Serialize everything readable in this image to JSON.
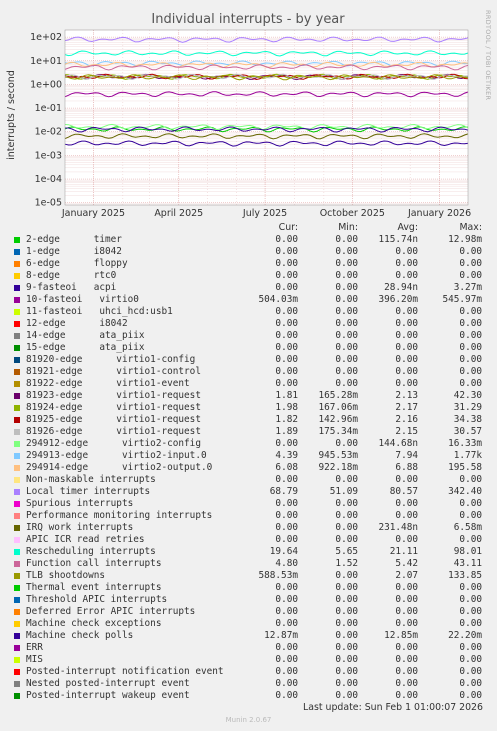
{
  "chart_data": {
    "type": "line",
    "title": "Individual interrupts - by year",
    "ylabel": "interrupts / second",
    "yscale": "log",
    "ylim": [
      8e-06,
      200
    ],
    "yticks": [
      {
        "value": 100,
        "label": "1e+02"
      },
      {
        "value": 10,
        "label": "1e+01"
      },
      {
        "value": 1,
        "label": "1e+00"
      },
      {
        "value": 0.1,
        "label": "1e-01"
      },
      {
        "value": 0.01,
        "label": "1e-02"
      },
      {
        "value": 0.001,
        "label": "1e-03"
      },
      {
        "value": 0.0001,
        "label": "1e-04"
      },
      {
        "value": 1e-05,
        "label": "1e-05"
      }
    ],
    "xlim": [
      "2024-12-02",
      "2026-01-31"
    ],
    "xticks": [
      {
        "date": "2025-01-01",
        "label": "January 2025"
      },
      {
        "date": "2025-04-01",
        "label": "April 2025"
      },
      {
        "date": "2025-07-01",
        "label": "July 2025"
      },
      {
        "date": "2025-10-01",
        "label": "October 2025"
      },
      {
        "date": "2026-01-01",
        "label": "January 2026"
      }
    ],
    "side_text": "RRDTOOL / TOBI OETIKER",
    "columns": [
      "Cur:",
      "Min:",
      "Avg:",
      "Max:"
    ],
    "series": [
      {
        "name": "2-edge      timer",
        "color": "#00cc00",
        "cur": "0.00",
        "min": "0.00",
        "avg": "115.74n",
        "max": "12.98m"
      },
      {
        "name": "1-edge      i8042",
        "color": "#0066b3",
        "cur": "0.00",
        "min": "0.00",
        "avg": "0.00",
        "max": "0.00"
      },
      {
        "name": "6-edge      floppy",
        "color": "#ff8000",
        "cur": "0.00",
        "min": "0.00",
        "avg": "0.00",
        "max": "0.00"
      },
      {
        "name": "8-edge      rtc0",
        "color": "#ffcc00",
        "cur": "0.00",
        "min": "0.00",
        "avg": "0.00",
        "max": "0.00"
      },
      {
        "name": "9-fasteoi   acpi",
        "color": "#330099",
        "cur": "0.00",
        "min": "0.00",
        "avg": "28.94n",
        "max": "3.27m"
      },
      {
        "name": "10-fasteoi   virtio0",
        "color": "#990099",
        "cur": "504.03m",
        "min": "0.00",
        "avg": "396.20m",
        "max": "545.97m"
      },
      {
        "name": "11-fasteoi   uhci_hcd:usb1",
        "color": "#ccff00",
        "cur": "0.00",
        "min": "0.00",
        "avg": "0.00",
        "max": "0.00"
      },
      {
        "name": "12-edge      i8042",
        "color": "#ff0000",
        "cur": "0.00",
        "min": "0.00",
        "avg": "0.00",
        "max": "0.00"
      },
      {
        "name": "14-edge      ata_piix",
        "color": "#808080",
        "cur": "0.00",
        "min": "0.00",
        "avg": "0.00",
        "max": "0.00"
      },
      {
        "name": "15-edge      ata_piix",
        "color": "#008f00",
        "cur": "0.00",
        "min": "0.00",
        "avg": "0.00",
        "max": "0.00"
      },
      {
        "name": "81920-edge      virtio1-config",
        "color": "#00487d",
        "cur": "0.00",
        "min": "0.00",
        "avg": "0.00",
        "max": "0.00"
      },
      {
        "name": "81921-edge      virtio1-control",
        "color": "#b35a00",
        "cur": "0.00",
        "min": "0.00",
        "avg": "0.00",
        "max": "0.00"
      },
      {
        "name": "81922-edge      virtio1-event",
        "color": "#b38f00",
        "cur": "0.00",
        "min": "0.00",
        "avg": "0.00",
        "max": "0.00"
      },
      {
        "name": "81923-edge      virtio1-request",
        "color": "#6b006b",
        "cur": "1.81",
        "min": "165.28m",
        "avg": "2.13",
        "max": "42.30"
      },
      {
        "name": "81924-edge      virtio1-request",
        "color": "#8fb300",
        "cur": "1.98",
        "min": "167.06m",
        "avg": "2.17",
        "max": "31.29"
      },
      {
        "name": "81925-edge      virtio1-request",
        "color": "#b30000",
        "cur": "1.82",
        "min": "142.96m",
        "avg": "2.16",
        "max": "34.38"
      },
      {
        "name": "81926-edge      virtio1-request",
        "color": "#bebebe",
        "cur": "1.89",
        "min": "175.34m",
        "avg": "2.15",
        "max": "30.57"
      },
      {
        "name": "294912-edge      virtio2-config",
        "color": "#80ff80",
        "cur": "0.00",
        "min": "0.00",
        "avg": "144.68n",
        "max": "16.33m"
      },
      {
        "name": "294913-edge      virtio2-input.0",
        "color": "#80c9ff",
        "cur": "4.39",
        "min": "945.53m",
        "avg": "7.94",
        "max": "1.77k"
      },
      {
        "name": "294914-edge      virtio2-output.0",
        "color": "#ffc080",
        "cur": "6.08",
        "min": "922.18m",
        "avg": "6.88",
        "max": "195.58"
      },
      {
        "name": "Non-maskable interrupts",
        "color": "#ffe680",
        "cur": "0.00",
        "min": "0.00",
        "avg": "0.00",
        "max": "0.00"
      },
      {
        "name": "Local timer interrupts",
        "color": "#aa80ff",
        "cur": "68.79",
        "min": "51.09",
        "avg": "80.57",
        "max": "342.40"
      },
      {
        "name": "Spurious interrupts",
        "color": "#ee00cc",
        "cur": "0.00",
        "min": "0.00",
        "avg": "0.00",
        "max": "0.00"
      },
      {
        "name": "Performance monitoring interrupts",
        "color": "#ff8080",
        "cur": "0.00",
        "min": "0.00",
        "avg": "0.00",
        "max": "0.00"
      },
      {
        "name": "IRQ work interrupts",
        "color": "#666600",
        "cur": "0.00",
        "min": "0.00",
        "avg": "231.48n",
        "max": "6.58m"
      },
      {
        "name": "APIC ICR read retries",
        "color": "#ffbfff",
        "cur": "0.00",
        "min": "0.00",
        "avg": "0.00",
        "max": "0.00"
      },
      {
        "name": "Rescheduling interrupts",
        "color": "#00ffcc",
        "cur": "19.64",
        "min": "5.65",
        "avg": "21.11",
        "max": "98.01"
      },
      {
        "name": "Function call interrupts",
        "color": "#cc6699",
        "cur": "4.80",
        "min": "1.52",
        "avg": "5.42",
        "max": "43.11"
      },
      {
        "name": "TLB shootdowns",
        "color": "#999900",
        "cur": "588.53m",
        "min": "0.00",
        "avg": "2.07",
        "max": "133.85"
      },
      {
        "name": "Thermal event interrupts",
        "color": "#00cc00",
        "cur": "0.00",
        "min": "0.00",
        "avg": "0.00",
        "max": "0.00"
      },
      {
        "name": "Threshold APIC interrupts",
        "color": "#0066b3",
        "cur": "0.00",
        "min": "0.00",
        "avg": "0.00",
        "max": "0.00"
      },
      {
        "name": "Deferred Error APIC interrupts",
        "color": "#ff8000",
        "cur": "0.00",
        "min": "0.00",
        "avg": "0.00",
        "max": "0.00"
      },
      {
        "name": "Machine check exceptions",
        "color": "#ffcc00",
        "cur": "0.00",
        "min": "0.00",
        "avg": "0.00",
        "max": "0.00"
      },
      {
        "name": "Machine check polls",
        "color": "#330099",
        "cur": "12.87m",
        "min": "0.00",
        "avg": "12.85m",
        "max": "22.20m"
      },
      {
        "name": "ERR",
        "color": "#990099",
        "cur": "0.00",
        "min": "0.00",
        "avg": "0.00",
        "max": "0.00"
      },
      {
        "name": "MIS",
        "color": "#ccff00",
        "cur": "0.00",
        "min": "0.00",
        "avg": "0.00",
        "max": "0.00"
      },
      {
        "name": "Posted-interrupt notification event",
        "color": "#ff0000",
        "cur": "0.00",
        "min": "0.00",
        "avg": "0.00",
        "max": "0.00"
      },
      {
        "name": "Nested posted-interrupt event",
        "color": "#808080",
        "cur": "0.00",
        "min": "0.00",
        "avg": "0.00",
        "max": "0.00"
      },
      {
        "name": "Posted-interrupt wakeup event",
        "color": "#008f00",
        "cur": "0.00",
        "min": "0.00",
        "avg": "0.00",
        "max": "0.00"
      }
    ]
  },
  "last_update": "Last update: Sun Feb  1 01:00:07 2026",
  "footer": "Munin 2.0.67"
}
